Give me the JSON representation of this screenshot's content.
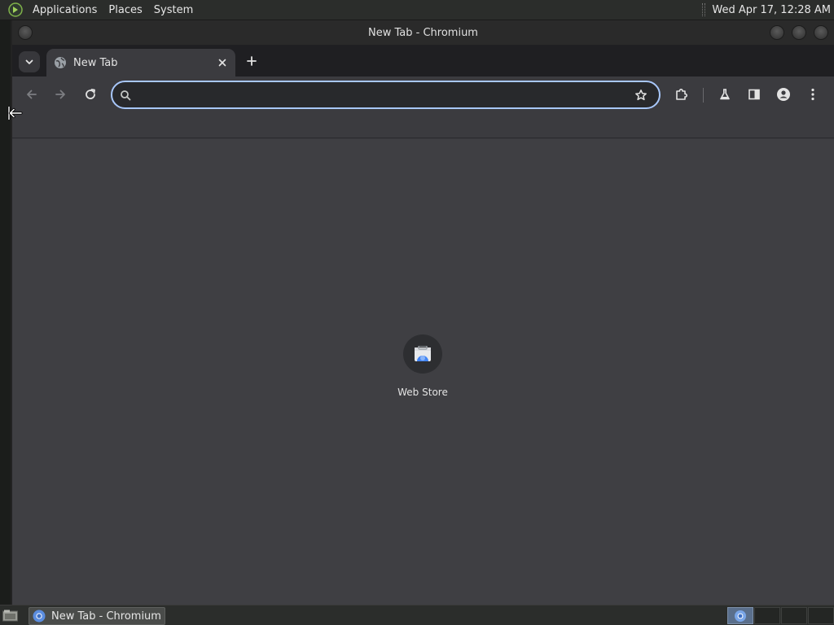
{
  "top_panel": {
    "menus": [
      "Applications",
      "Places",
      "System"
    ],
    "clock": "Wed Apr 17, 12:28 AM"
  },
  "window": {
    "title": "New Tab - Chromium"
  },
  "tabs": [
    {
      "title": "New Tab"
    }
  ],
  "omnibox": {
    "value": "",
    "placeholder": ""
  },
  "new_tab_page": {
    "shortcuts": [
      {
        "label": "Web Store",
        "icon": "web-store-icon"
      }
    ]
  },
  "taskbar": {
    "items": [
      {
        "label": "New Tab - Chromium",
        "icon": "chromium-icon"
      }
    ]
  },
  "colors": {
    "accent": "#a8c7fa",
    "content_bg": "#3f3f43",
    "toolbar_bg": "#3b3b3f"
  }
}
